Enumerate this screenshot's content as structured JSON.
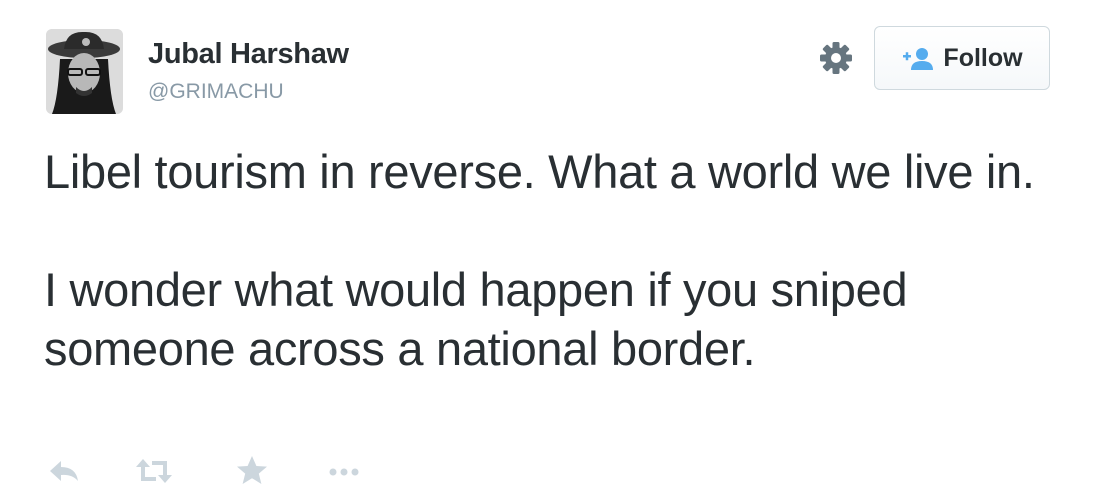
{
  "author": {
    "display_name": "Jubal Harshaw",
    "handle": "@GRIMACHU"
  },
  "follow_button": {
    "label": "Follow"
  },
  "tweet": {
    "paragraphs": [
      "Libel tourism in reverse. What a world we live in.",
      "I wonder what would happen if you sniped someone across a national border."
    ]
  },
  "actions": [
    {
      "icon": "reply-icon"
    },
    {
      "icon": "retweet-icon"
    },
    {
      "icon": "favorite-icon"
    },
    {
      "icon": "more-icon"
    }
  ],
  "colors": {
    "text": "#292f33",
    "secondary": "#8899a6",
    "icon_muted": "#ccd6dd",
    "follow_icon": "#55acee"
  }
}
